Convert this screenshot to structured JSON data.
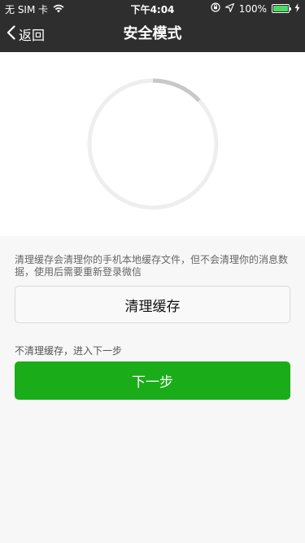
{
  "status_bar": {
    "carrier": "无 SIM 卡",
    "time": "下午4:04",
    "battery_percent": "100%",
    "battery_level": 1.0,
    "icons": [
      "wifi-icon",
      "orientation-lock-icon",
      "location-arrow-icon",
      "battery-icon",
      "charging-bolt-icon"
    ]
  },
  "nav": {
    "back_label": "返回",
    "title": "安全模式",
    "bar_color": "#2e2e2e"
  },
  "spinner": {
    "icon": "loading-spinner-icon",
    "progress_fraction": 0.13,
    "track_color": "#eeeeee",
    "arc_color": "#c8c8c8"
  },
  "main": {
    "description": "清理缓存会清理你的手机本地缓存文件，但不会清理你的消息数据，使用后需要重新登录微信",
    "clear_button_label": "清理缓存",
    "skip_text": "不清理缓存，进入下一步",
    "next_button_label": "下一步",
    "accent_color": "#1aad19"
  }
}
